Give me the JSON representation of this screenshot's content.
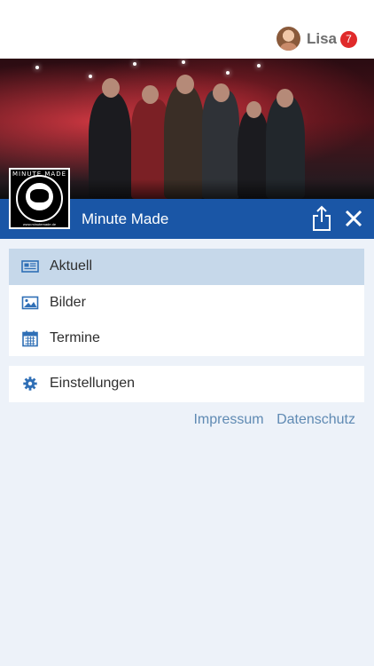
{
  "user": {
    "name": "Lisa",
    "notifications": "7"
  },
  "band": {
    "name": "Minute Made",
    "logo_title": "MINUTE MADE",
    "logo_url": "www.minutemade.de"
  },
  "menu": {
    "items": [
      {
        "label": "Aktuell",
        "icon": "newspaper-icon",
        "active": true
      },
      {
        "label": "Bilder",
        "icon": "image-icon",
        "active": false
      },
      {
        "label": "Termine",
        "icon": "calendar-icon",
        "active": false
      }
    ],
    "settings": {
      "label": "Einstellungen",
      "icon": "gear-icon"
    }
  },
  "footer": {
    "impressum": "Impressum",
    "datenschutz": "Datenschutz"
  },
  "colors": {
    "primary": "#1a56a6",
    "active_row": "#c6d8ea",
    "background": "#edf2f9",
    "link": "#5f8ab3",
    "badge": "#e02a2a",
    "icon": "#2f6fb6"
  }
}
